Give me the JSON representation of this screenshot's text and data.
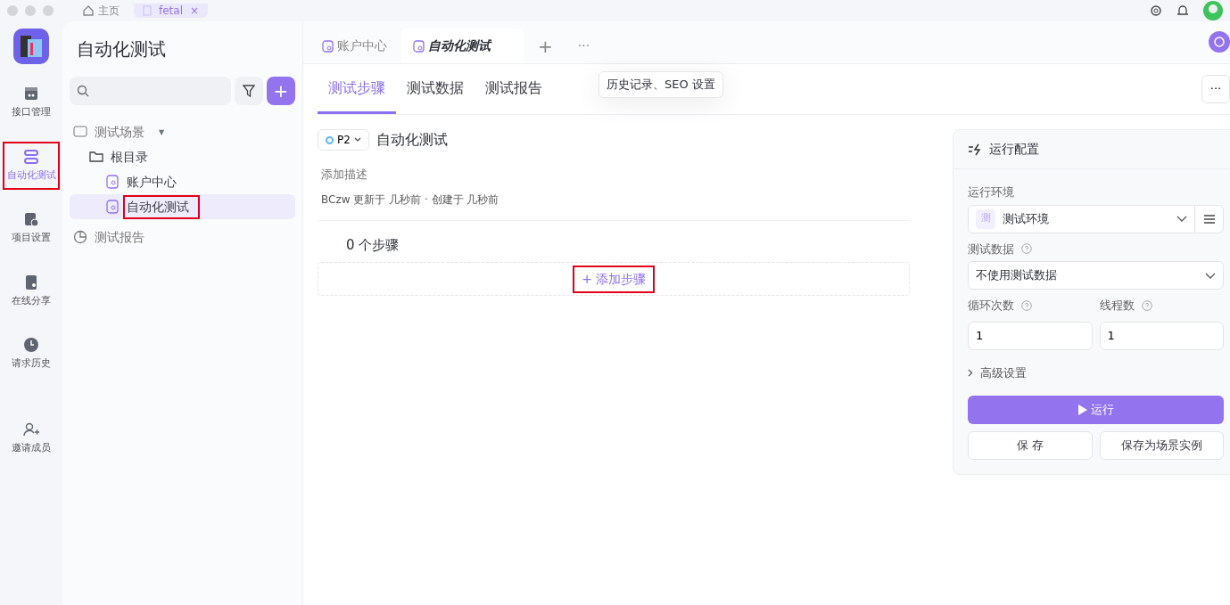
{
  "top_bar": {
    "home_tab": "主页",
    "tabs": [
      {
        "label": "fetal",
        "close": "×",
        "selected": true
      }
    ]
  },
  "rail": {
    "items": [
      {
        "label": "接口管理",
        "kind": "api",
        "selected": false,
        "highlighted": false
      },
      {
        "label": "自动化测试",
        "kind": "auto",
        "selected": true,
        "highlighted": true
      },
      {
        "label": "项目设置",
        "kind": "settings",
        "selected": false,
        "highlighted": false
      },
      {
        "label": "在线分享",
        "kind": "share",
        "selected": false,
        "highlighted": false
      },
      {
        "label": "请求历史",
        "kind": "history",
        "selected": false,
        "highlighted": false
      }
    ],
    "bottom_item": {
      "label": "邀请成员"
    }
  },
  "panel": {
    "title": "自动化测试",
    "add_button": "+",
    "tree": [
      {
        "label": "测试场景",
        "kind": "group",
        "caret": "▾",
        "expanded": true,
        "selected": false,
        "highlighted": false,
        "children": [
          {
            "label": "根目录",
            "kind": "folder",
            "selected": false,
            "highlighted": false,
            "children": [
              {
                "label": "账户中心",
                "kind": "scenario",
                "selected": false,
                "highlighted": false
              },
              {
                "label": "自动化测试",
                "kind": "scenario",
                "selected": true,
                "highlighted": true
              }
            ]
          }
        ]
      },
      {
        "label": "测试报告",
        "kind": "report",
        "selected": false,
        "highlighted": false
      }
    ]
  },
  "doc_tabs": [
    {
      "label": "账户中心",
      "selected": false
    },
    {
      "label": "自动化测试",
      "selected": true
    }
  ],
  "doc_tab_add": "+",
  "doc_tab_more": "···",
  "sub_tabs": [
    {
      "label": "测试步骤",
      "selected": true
    },
    {
      "label": "测试数据",
      "selected": false
    },
    {
      "label": "测试报告",
      "selected": false
    }
  ],
  "tooltip": "历史记录、SEO 设置",
  "more_button": "···",
  "scenario": {
    "priority": {
      "label": "P2",
      "color": "#5cb8f5"
    },
    "title": "自动化测试",
    "description_placeholder": "添加描述",
    "meta": "BCzw 更新于 几秒前 · 创建于 几秒前",
    "step_count": "0 个步骤",
    "add_step": {
      "icon": "+",
      "label": "添加步骤",
      "highlighted": true
    }
  },
  "run_config": {
    "title": "运行配置",
    "environment": {
      "label": "运行环境",
      "badge": "测",
      "value": "测试环境"
    },
    "test_data": {
      "label": "测试数据",
      "value": "不使用测试数据"
    },
    "loops": {
      "label": "循环次数",
      "value": "1"
    },
    "threads": {
      "label": "线程数",
      "value": "1"
    },
    "advanced": {
      "label": "高级设置",
      "expanded": false
    },
    "run_button": "运行",
    "save_button": "保 存",
    "save_instance_button": "保存为场景实例"
  }
}
